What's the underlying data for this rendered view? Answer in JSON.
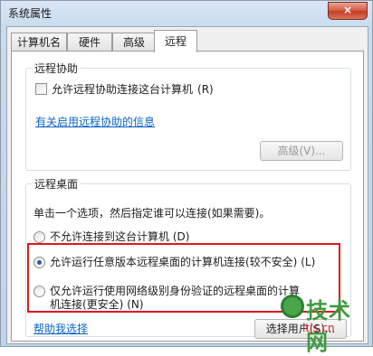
{
  "window": {
    "title": "系统属性",
    "close_glyph": "×"
  },
  "tabs": [
    {
      "label": "计算机名"
    },
    {
      "label": "硬件"
    },
    {
      "label": "高级"
    },
    {
      "label": "远程",
      "active": true
    }
  ],
  "remote_assistance": {
    "group_title": "远程协助",
    "allow_checkbox_label": "允许远程协助连接这台计算机",
    "allow_checkbox_hotkey": "(R)",
    "allow_checked": false,
    "info_link": "有关启用远程协助的信息",
    "advanced_button": "高级(V)..."
  },
  "remote_desktop": {
    "group_title": "远程桌面",
    "instruction": "单击一个选项，然后指定谁可以连接(如果需要)。",
    "options": [
      {
        "label": "不允许连接到这台计算机",
        "hotkey": "(D)",
        "checked": false
      },
      {
        "label": "允许运行任意版本远程桌面的计算机连接(较不安全)",
        "hotkey": "(L)",
        "checked": true
      },
      {
        "label_line1": "仅允许运行使用网络级别身份验证的远程桌面的计算",
        "label_line2": "机连接(更安全)",
        "hotkey": "(N)",
        "checked": false
      }
    ],
    "help_link": "帮助我选择",
    "select_users_button": "选择用户(S)..."
  },
  "watermark": {
    "brand": "技术网",
    "url": "itjs.cn"
  },
  "colors": {
    "highlight": "#e0181b",
    "link": "#0a64c8",
    "close": "#c43c22"
  }
}
